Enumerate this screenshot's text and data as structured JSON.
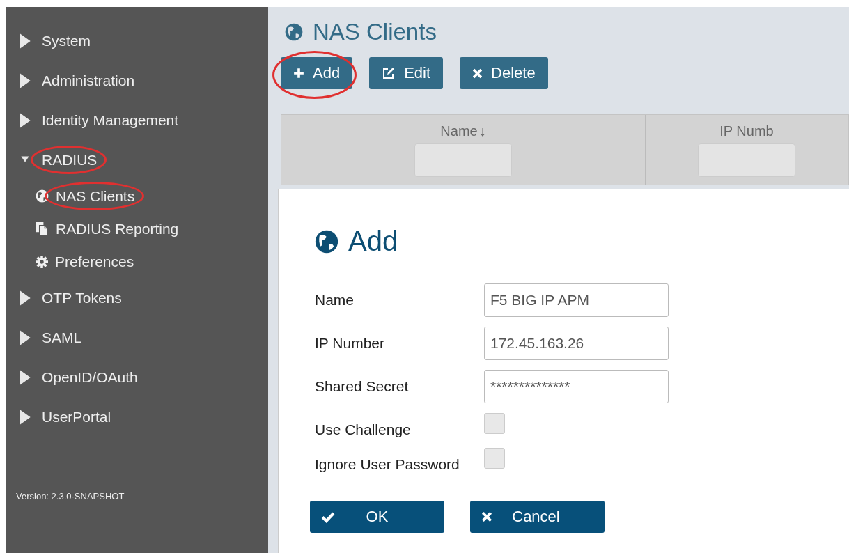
{
  "sidebar": {
    "items": [
      {
        "label": "System",
        "expanded": false,
        "circled": false
      },
      {
        "label": "Administration",
        "expanded": false,
        "circled": false
      },
      {
        "label": "Identity Management",
        "expanded": false,
        "circled": false
      },
      {
        "label": "RADIUS",
        "expanded": true,
        "circled": true,
        "children": [
          {
            "label": "NAS Clients",
            "kind": "globe",
            "circled": true
          },
          {
            "label": "RADIUS Reporting",
            "kind": "document",
            "circled": false
          },
          {
            "label": "Preferences",
            "kind": "gear",
            "circled": false
          }
        ]
      },
      {
        "label": "OTP Tokens",
        "expanded": false,
        "circled": false
      },
      {
        "label": "SAML",
        "expanded": false,
        "circled": false
      },
      {
        "label": "OpenID/OAuth",
        "expanded": false,
        "circled": false
      },
      {
        "label": "UserPortal",
        "expanded": false,
        "circled": false
      }
    ],
    "version": "Version: 2.3.0-SNAPSHOT"
  },
  "page": {
    "title": "NAS Clients",
    "toolbar": [
      {
        "label": "Add",
        "kind": "add",
        "circled": true
      },
      {
        "label": "Edit",
        "kind": "edit",
        "circled": false
      },
      {
        "label": "Delete",
        "kind": "delete",
        "circled": false
      }
    ],
    "table": {
      "columns": [
        {
          "label": "Name",
          "sort": "↓"
        },
        {
          "label": "IP Numb"
        }
      ]
    }
  },
  "dialog": {
    "title": "Add",
    "fields": [
      {
        "kind": "text",
        "label": "Name",
        "value": "F5 BIG IP APM"
      },
      {
        "kind": "text",
        "label": "IP Number",
        "value": "172.45.163.26"
      },
      {
        "kind": "text",
        "label": "Shared Secret",
        "value": "**************"
      },
      {
        "kind": "checkbox",
        "label": "Use Challenge",
        "checked": false
      },
      {
        "kind": "checkbox",
        "label": "Ignore User Password",
        "checked": false
      }
    ],
    "buttons": [
      {
        "label": "OK",
        "kind": "ok"
      },
      {
        "label": "Cancel",
        "kind": "cancel"
      }
    ]
  }
}
